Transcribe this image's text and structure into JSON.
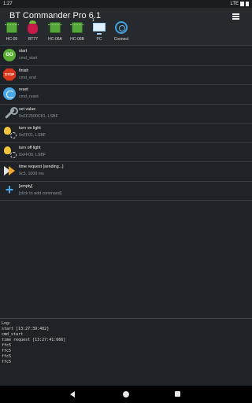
{
  "status_bar": {
    "time": "1:27",
    "network": "LTE"
  },
  "app": {
    "title": "BT Commander Pro 6.1"
  },
  "devices": [
    {
      "label": "HC-05",
      "icon": "chip-icon"
    },
    {
      "label": "BT77",
      "icon": "raspberry-pi-icon"
    },
    {
      "label": "HC-06A",
      "icon": "chip-icon"
    },
    {
      "label": "HC-06B",
      "icon": "chip-icon"
    },
    {
      "label": "PC",
      "badge": "1",
      "icon": "monitor-icon"
    },
    {
      "label": "Connect",
      "icon": "bluetooth-signal-icon"
    }
  ],
  "commands": [
    {
      "name": "start",
      "cmd": "cmd_start",
      "icon": "go-icon",
      "icon_text": "GO"
    },
    {
      "name": "finish",
      "cmd": "cmd_end",
      "icon": "stop-icon",
      "icon_text": "STOP"
    },
    {
      "name": "reset",
      "cmd": "cmd_reset",
      "icon": "reset-icon"
    },
    {
      "name": "set value",
      "cmd": "0xFF2500C81, LSBF",
      "icon": "wrench-icon"
    },
    {
      "name": "turn on light",
      "cmd": "0xFF01, LSBF",
      "icon": "lightbulb-gear-icon"
    },
    {
      "name": "turn off light",
      "cmd": "0xFF00, LSBF",
      "icon": "lightbulb-gear-icon"
    },
    {
      "name": "time request  [sending...]",
      "cmd": "9c5, 1000 ms",
      "icon": "timer-play-icon"
    },
    {
      "name": "[empty]",
      "cmd": "[click to add command]",
      "icon": "plus-icon",
      "icon_text": "+"
    }
  ],
  "log": {
    "lines": [
      "Log:",
      "start [13:27:39:402]",
      "cmd_start",
      "time request [13:27:41:666]",
      "ffc5",
      "ffc5",
      "ffc5",
      "ffc5"
    ]
  }
}
